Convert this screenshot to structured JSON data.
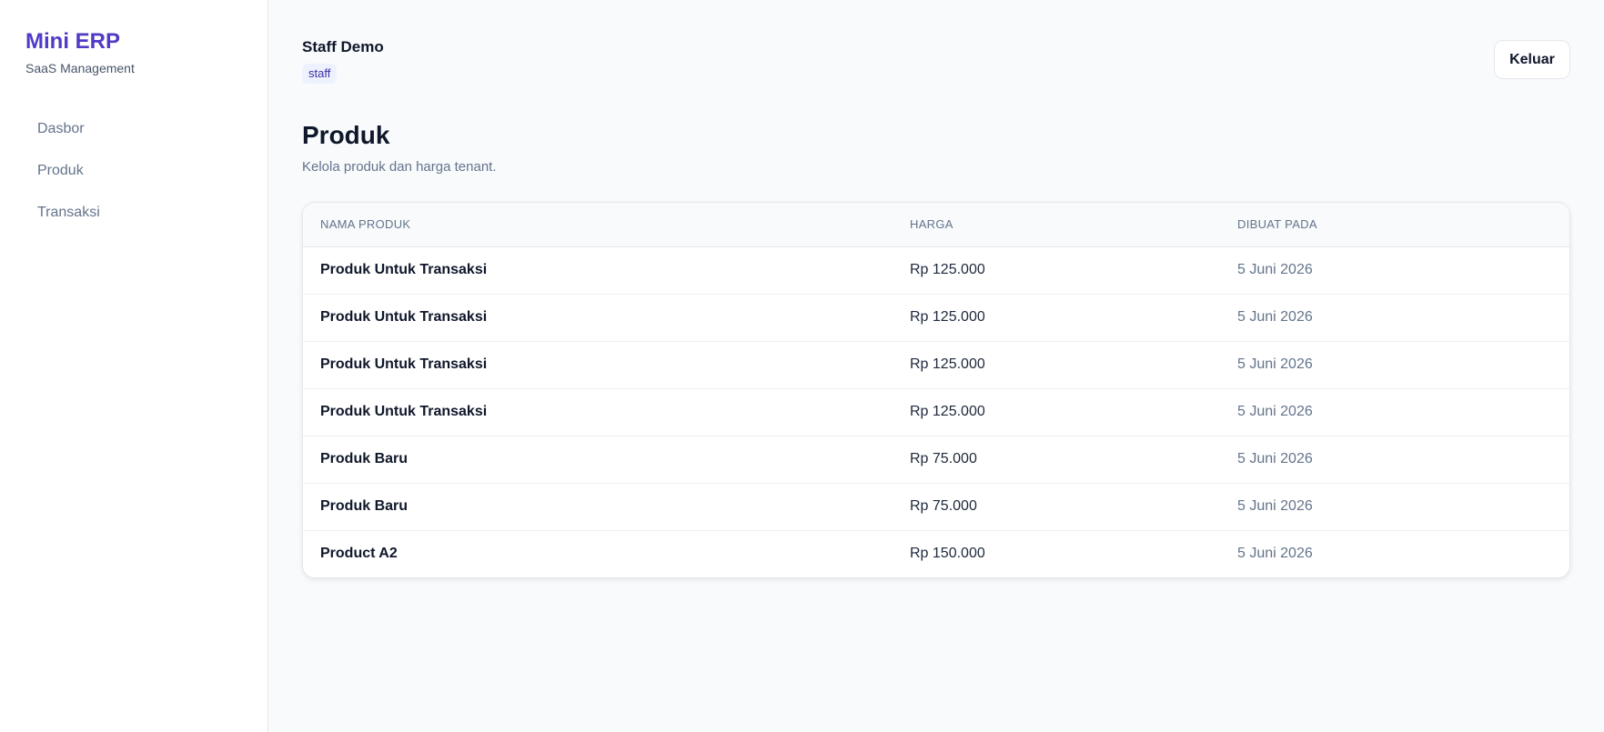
{
  "sidebar": {
    "brand": "Mini ERP",
    "subtitle": "SaaS Management",
    "items": [
      {
        "label": "Dasbor"
      },
      {
        "label": "Produk"
      },
      {
        "label": "Transaksi"
      }
    ]
  },
  "header": {
    "user_name": "Staff Demo",
    "role": "staff",
    "logout_label": "Keluar"
  },
  "page": {
    "title": "Produk",
    "description": "Kelola produk dan harga tenant."
  },
  "table": {
    "columns": [
      "NAMA PRODUK",
      "HARGA",
      "DIBUAT PADA"
    ],
    "rows": [
      {
        "name": "Produk Untuk Transaksi",
        "price": "Rp 125.000",
        "created": "5 Juni 2026"
      },
      {
        "name": "Produk Untuk Transaksi",
        "price": "Rp 125.000",
        "created": "5 Juni 2026"
      },
      {
        "name": "Produk Untuk Transaksi",
        "price": "Rp 125.000",
        "created": "5 Juni 2026"
      },
      {
        "name": "Produk Untuk Transaksi",
        "price": "Rp 125.000",
        "created": "5 Juni 2026"
      },
      {
        "name": "Produk Baru",
        "price": "Rp 75.000",
        "created": "5 Juni 2026"
      },
      {
        "name": "Produk Baru",
        "price": "Rp 75.000",
        "created": "5 Juni 2026"
      },
      {
        "name": "Product A2",
        "price": "Rp 150.000",
        "created": "5 Juni 2026"
      }
    ]
  },
  "colors": {
    "brand": "#4f3bc6",
    "background": "#f8fafc",
    "badge_bg": "#eef2ff",
    "badge_text": "#3730a3"
  }
}
